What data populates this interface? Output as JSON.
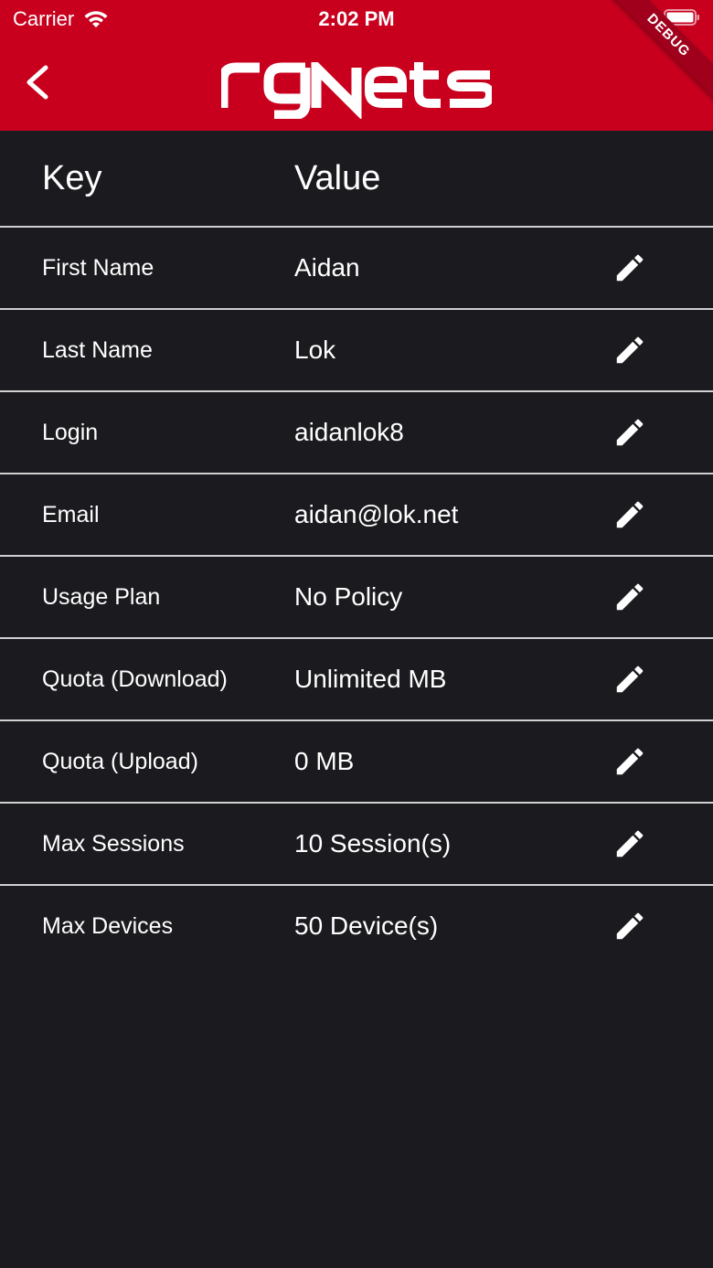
{
  "status_bar": {
    "carrier": "Carrier",
    "time": "2:02 PM"
  },
  "header": {
    "brand": "rgNets",
    "debug_banner": "DEBUG",
    "background_color": "#c8001e"
  },
  "table": {
    "key_header": "Key",
    "value_header": "Value",
    "rows": [
      {
        "key": "First Name",
        "value": "Aidan"
      },
      {
        "key": "Last Name",
        "value": "Lok"
      },
      {
        "key": "Login",
        "value": "aidanlok8"
      },
      {
        "key": "Email",
        "value": "aidan@lok.net"
      },
      {
        "key": "Usage Plan",
        "value": "No Policy"
      },
      {
        "key": "Quota (Download)",
        "value": "Unlimited MB"
      },
      {
        "key": "Quota (Upload)",
        "value": "0 MB"
      },
      {
        "key": "Max Sessions",
        "value": "10 Session(s)"
      },
      {
        "key": "Max Devices",
        "value": "50 Device(s)"
      }
    ]
  },
  "icons": {
    "back": "chevron-left-icon",
    "edit": "pencil-icon",
    "wifi": "wifi-icon",
    "battery": "battery-icon"
  }
}
